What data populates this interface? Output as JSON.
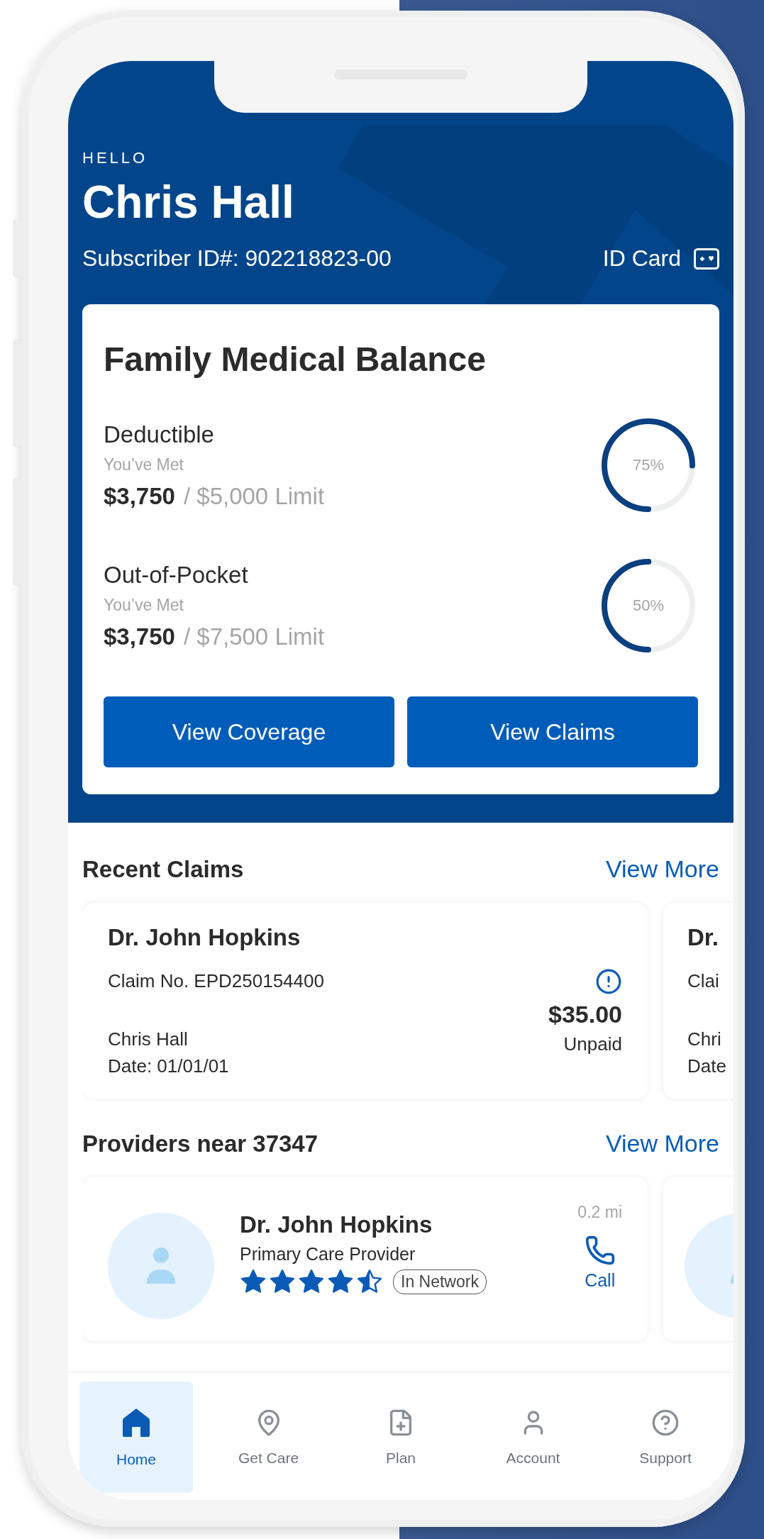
{
  "header": {
    "greeting": "HELLO",
    "name": "Chris Hall",
    "subscriber_id": "Subscriber ID#: 902218823-00",
    "id_card_label": "ID Card"
  },
  "balance": {
    "title": "Family Medical Balance",
    "items": [
      {
        "label": "Deductible",
        "met_label": "You’ve Met",
        "met_amount": "$3,750",
        "limit": "/ $5,000 Limit",
        "level": 0.75,
        "percent": "75%"
      },
      {
        "label": "Out-of-Pocket",
        "met_label": "You’ve Met",
        "met_amount": "$3,750",
        "limit": "/ $7,500 Limit",
        "level": 0.5,
        "percent": "50%"
      }
    ],
    "buttons": [
      "View Coverage",
      "View Claims"
    ]
  },
  "recent_claims": {
    "title": "Recent Claims",
    "link": "View More",
    "cards": [
      {
        "provider": "Dr. John Hopkins",
        "claim_no": "Claim No. EPD250154400",
        "member": "Chris Hall",
        "date": "Date: 01/01/01",
        "amount": "$35.00",
        "status": "Unpaid"
      }
    ],
    "peek_card": {
      "provider": "Dr.",
      "line_1": "Clai",
      "line_2": "Chri",
      "line_3": "Date"
    }
  },
  "providers": {
    "title": "Providers near 37347",
    "link": "View More",
    "cards": [
      {
        "name": "Dr. John Hopkins",
        "specialty": "Primary Care Provider",
        "stars": 4.5,
        "network": "In Network",
        "distance": "0.2 mi",
        "action": "Call"
      }
    ]
  },
  "nav": [
    {
      "label": "Home",
      "kind": "home",
      "selected": true
    },
    {
      "label": "Get Care",
      "kind": "pin",
      "selected": false
    },
    {
      "label": "Plan",
      "kind": "document",
      "selected": false
    },
    {
      "label": "Account",
      "kind": "person",
      "selected": false
    },
    {
      "label": "Support",
      "kind": "help",
      "selected": false
    }
  ]
}
